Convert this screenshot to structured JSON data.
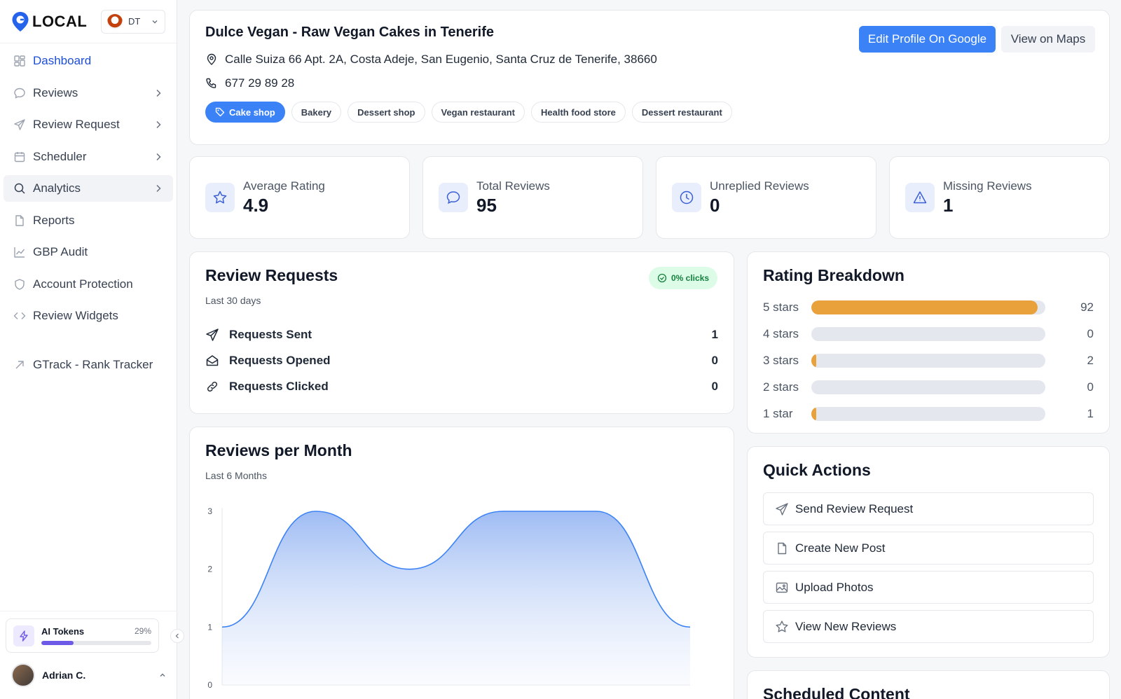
{
  "brand": {
    "logo_text": "LOCAL"
  },
  "location_switcher": {
    "label": "DT"
  },
  "sidebar": {
    "items": [
      {
        "label": "Dashboard"
      },
      {
        "label": "Reviews"
      },
      {
        "label": "Review Request"
      },
      {
        "label": "Scheduler"
      },
      {
        "label": "Analytics"
      },
      {
        "label": "Reports"
      },
      {
        "label": "GBP Audit"
      },
      {
        "label": "Account Protection"
      },
      {
        "label": "Review Widgets"
      },
      {
        "label": "GTrack - Rank Tracker"
      }
    ],
    "tokens": {
      "label": "AI Tokens",
      "percent_text": "29%",
      "fraction": 0.29
    },
    "user": {
      "name": "Adrian C."
    }
  },
  "profile": {
    "name": "Dulce Vegan - Raw Vegan Cakes in Tenerife",
    "address": "Calle Suiza 66 Apt. 2A, Costa Adeje, San Eugenio, Santa Cruz de Tenerife, 38660",
    "phone": "677 29 89 28",
    "categories": [
      "Cake shop",
      "Bakery",
      "Dessert shop",
      "Vegan restaurant",
      "Health food store",
      "Dessert restaurant"
    ],
    "edit_button": "Edit Profile On Google",
    "maps_button": "View on Maps"
  },
  "stats": [
    {
      "label": "Average Rating",
      "value": "4.9"
    },
    {
      "label": "Total Reviews",
      "value": "95"
    },
    {
      "label": "Unreplied Reviews",
      "value": "0"
    },
    {
      "label": "Missing Reviews",
      "value": "1"
    }
  ],
  "review_requests": {
    "title": "Review Requests",
    "subtitle": "Last 30 days",
    "badge": "0% clicks",
    "rows": [
      {
        "label": "Requests Sent",
        "value": "1"
      },
      {
        "label": "Requests Opened",
        "value": "0"
      },
      {
        "label": "Requests Clicked",
        "value": "0"
      }
    ]
  },
  "rating_breakdown": {
    "title": "Rating Breakdown",
    "rows": [
      {
        "label": "5 stars",
        "count": "92",
        "fraction": 0.968
      },
      {
        "label": "4 stars",
        "count": "0",
        "fraction": 0
      },
      {
        "label": "3 stars",
        "count": "2",
        "fraction": 0.021
      },
      {
        "label": "2 stars",
        "count": "0",
        "fraction": 0
      },
      {
        "label": "1 star",
        "count": "1",
        "fraction": 0.011
      }
    ]
  },
  "reviews_per_month": {
    "title": "Reviews per Month",
    "subtitle": "Last 6 Months"
  },
  "chart_data": {
    "type": "area",
    "title": "Reviews per Month",
    "x": [
      0,
      1,
      2,
      3,
      4,
      5
    ],
    "values": [
      1,
      3,
      2,
      3,
      3,
      1
    ],
    "yticks": [
      "0",
      "1",
      "2",
      "3"
    ],
    "ylim": [
      0,
      3
    ],
    "xlabel": "",
    "ylabel": "",
    "grid": false,
    "line_color": "#3b82f6"
  },
  "quick_actions": {
    "title": "Quick Actions",
    "items": [
      {
        "label": "Send Review Request"
      },
      {
        "label": "Create New Post"
      },
      {
        "label": "Upload Photos"
      },
      {
        "label": "View New Reviews"
      }
    ]
  },
  "scheduled": {
    "title": "Scheduled Content"
  }
}
